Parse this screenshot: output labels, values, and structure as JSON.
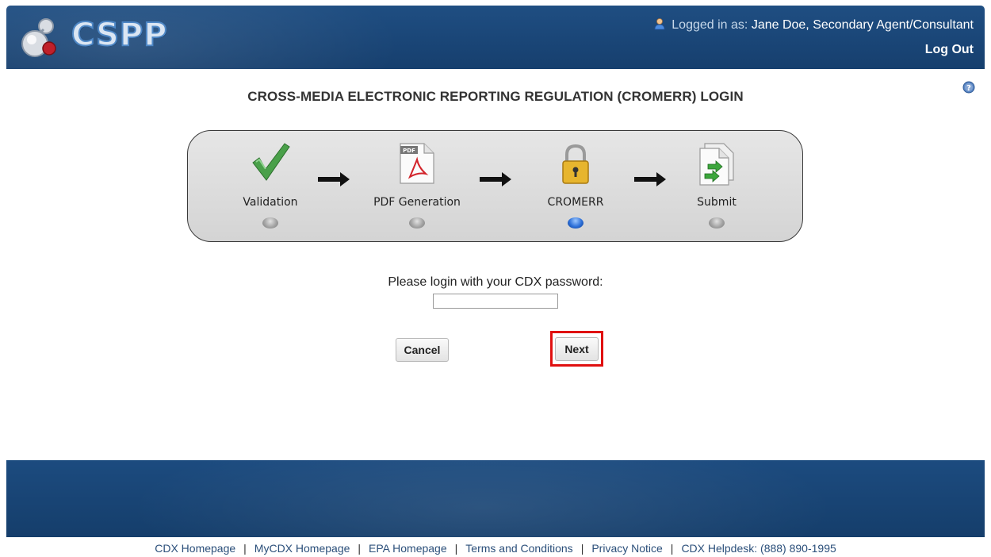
{
  "header": {
    "logo_text": "CSPP",
    "logged_in_prefix": "Logged in as:",
    "user_name": "Jane Doe, Secondary Agent/Consultant",
    "logout_label": "Log Out"
  },
  "page": {
    "title": "CROSS-MEDIA ELECTRONIC REPORTING REGULATION (CROMERR) LOGIN"
  },
  "progress": {
    "steps": [
      {
        "label": "Validation",
        "active": false
      },
      {
        "label": "PDF Generation",
        "active": false
      },
      {
        "label": "CROMERR",
        "active": true
      },
      {
        "label": "Submit",
        "active": false
      }
    ],
    "pdf_badge": "PDF"
  },
  "form": {
    "password_label": "Please login with your CDX password:",
    "password_value": "",
    "cancel_label": "Cancel",
    "next_label": "Next"
  },
  "footer": {
    "links": [
      {
        "label": "CDX Homepage"
      },
      {
        "label": "MyCDX Homepage"
      },
      {
        "label": "EPA Homepage"
      },
      {
        "label": "Terms and Conditions"
      },
      {
        "label": "Privacy Notice"
      },
      {
        "label": "CDX Helpdesk: (888) 890-1995"
      }
    ],
    "separator": "|"
  },
  "colors": {
    "header_bg": "#1f4e82",
    "footer_bg": "#1c4b7f",
    "highlight": "#e01010",
    "active_step": "#2c6fd8"
  },
  "icons": [
    "cspp-logo-icon",
    "user-icon",
    "help-icon",
    "checkmark-icon",
    "pdf-file-icon",
    "padlock-icon",
    "submit-file-icon",
    "right-arrow-icon"
  ]
}
